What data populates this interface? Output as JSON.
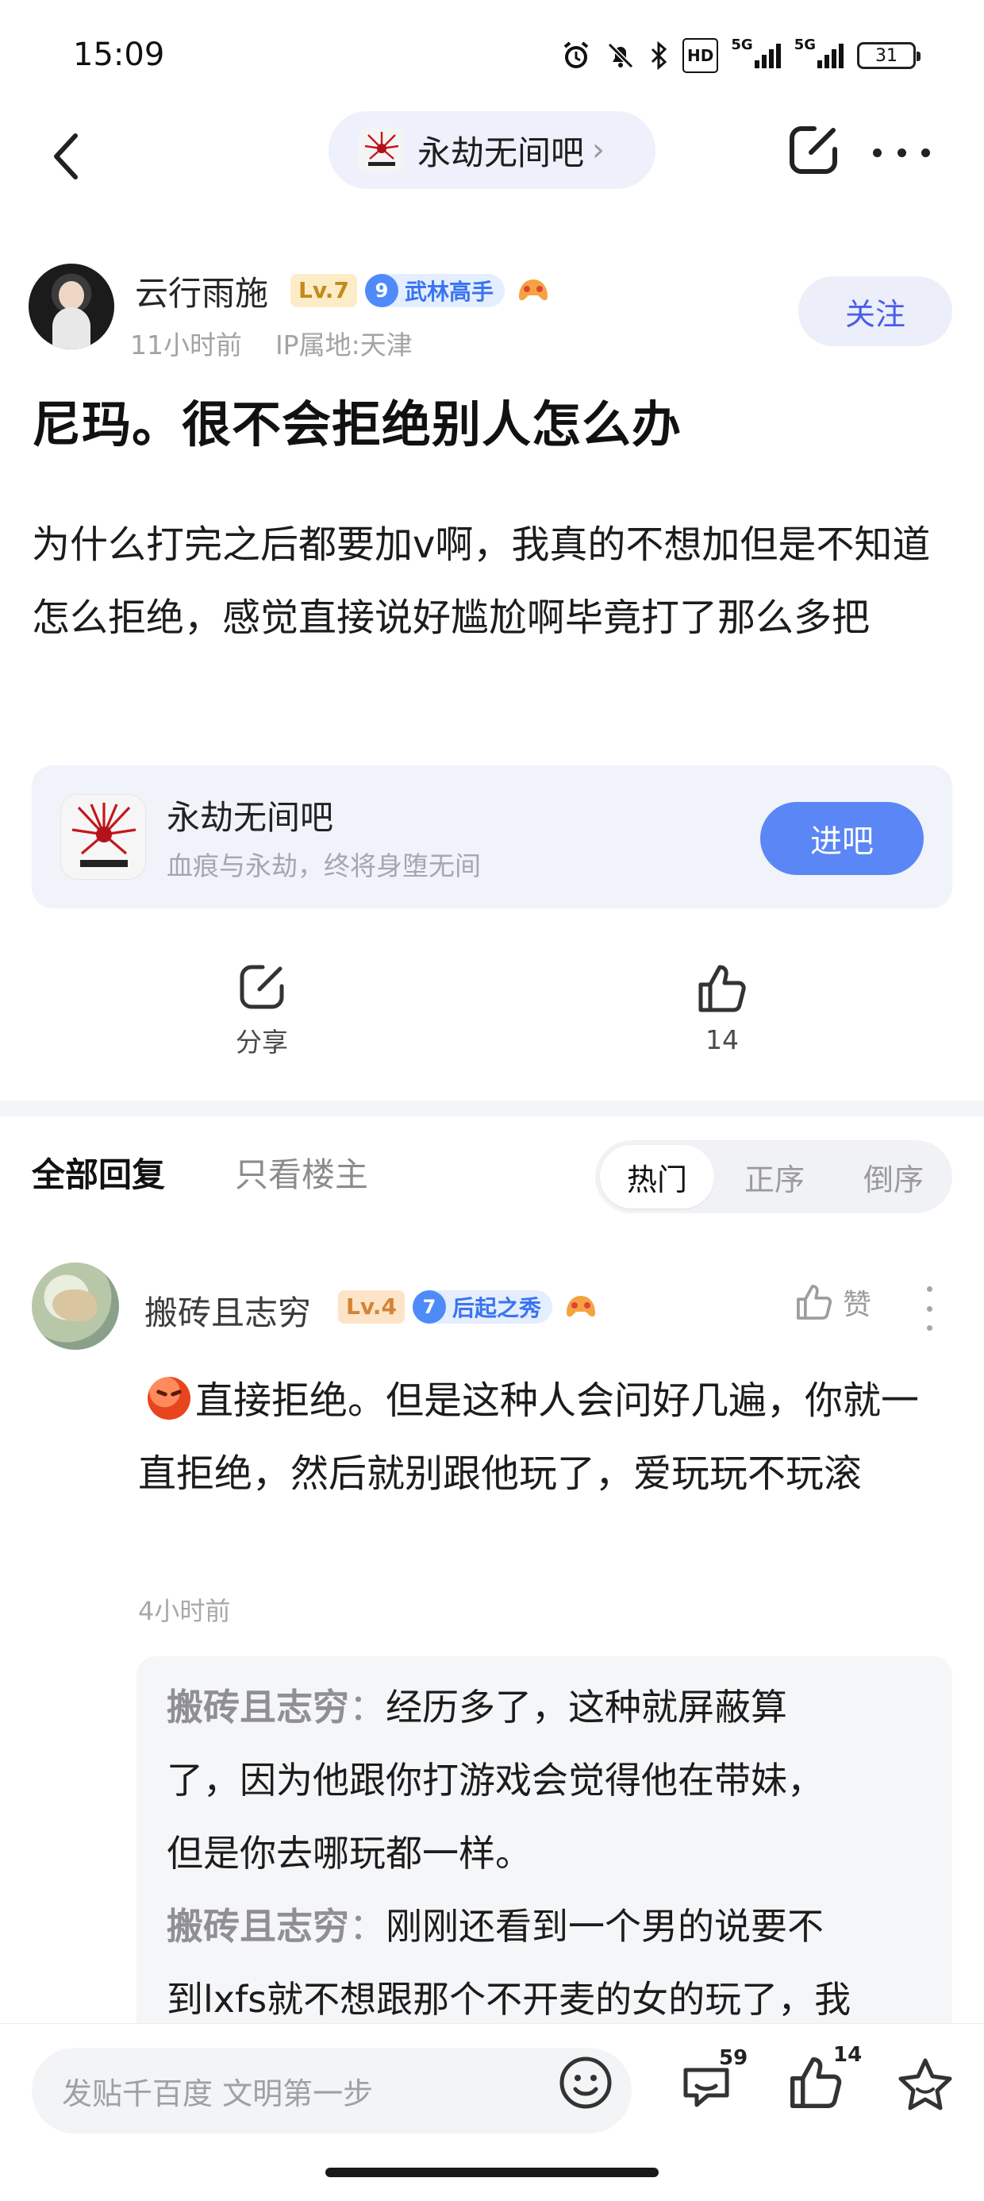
{
  "status_bar": {
    "time": "15:09",
    "battery": "31",
    "signal_1": "5G",
    "signal_2": "5G",
    "hd": "HD",
    "icons": [
      "alarm-icon",
      "mute-bell-icon",
      "bluetooth-icon",
      "hd-icon",
      "signal-icon",
      "signal-icon",
      "battery-icon"
    ]
  },
  "nav": {
    "forum_name": "永劫无间吧",
    "chevron": "›"
  },
  "post": {
    "author": {
      "name": "云行雨施",
      "level": "Lv.7",
      "title_level": "9",
      "title": "武林高手",
      "meta": "11小时前    IP属地:天津"
    },
    "follow_label": "关注",
    "title": "尼玛。很不会拒绝别人怎么办",
    "body": "为什么打完之后都要加v啊，我真的不想加但是不知道怎么拒绝，感觉直接说好尴尬啊毕竟打了那么多把"
  },
  "forum_card": {
    "name": "永劫无间吧",
    "slogan": "血痕与永劫，终将身堕无间",
    "enter_label": "进吧"
  },
  "actions": {
    "share_label": "分享",
    "like_count": "14"
  },
  "tabs": {
    "all": "全部回复",
    "owner_only": "只看楼主",
    "sort": [
      "热门",
      "正序",
      "倒序"
    ]
  },
  "comment": {
    "name": "搬砖且志穷",
    "level": "Lv.4",
    "title_level": "7",
    "title": "后起之秀",
    "like_label": "赞",
    "body": "直接拒绝。但是这种人会问好几遍，你就一直拒绝，然后就别跟他玩了，爱玩玩不玩滚",
    "time": "4小时前",
    "replies": [
      {
        "who": "搬砖且志穷",
        "sep": "：",
        "line1": "经历多了，这种就屏蔽算",
        "line2": "了，因为他跟你打游戏会觉得他在带妹，",
        "line3": "但是你去哪玩都一样。"
      },
      {
        "who": "搬砖且志穷",
        "sep": "：",
        "line1": "刚刚还看到一个男的说要不",
        "line2": "到lxfs就不想跟那个不开麦的女的玩了，我"
      }
    ]
  },
  "bottom_bar": {
    "placeholder": "发贴千百度 文明第一步",
    "comment_count": "59",
    "like_count": "14"
  },
  "colors": {
    "accent_blue": "#5b86f5",
    "follow_text": "#4a5ee6",
    "pill_bg": "#eef0fb"
  }
}
